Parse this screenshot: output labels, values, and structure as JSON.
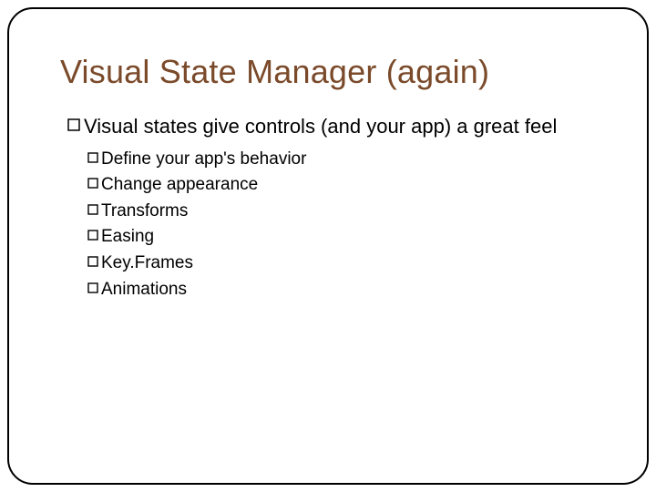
{
  "slide": {
    "title": "Visual State Manager (again)",
    "main_bullet": "Visual states give controls (and your app) a great feel",
    "sub_bullets": [
      "Define your app's behavior",
      "Change appearance",
      "Transforms",
      "Easing",
      "Key.Frames",
      "Animations"
    ]
  }
}
